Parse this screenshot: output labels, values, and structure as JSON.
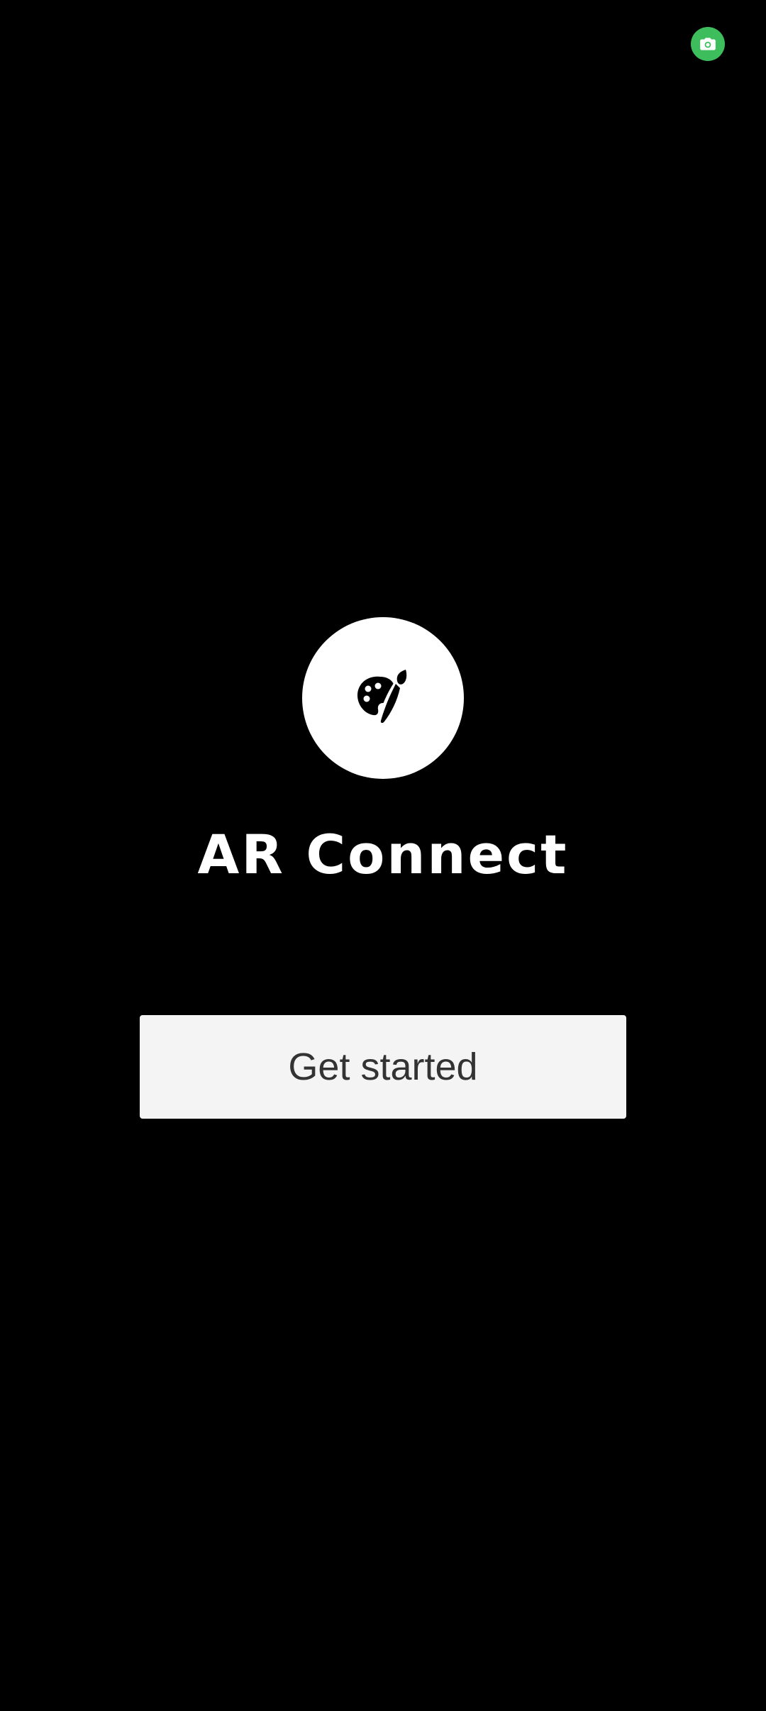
{
  "status": {
    "camera_indicator_icon": "camera-icon",
    "camera_indicator_color": "#3dbd5c"
  },
  "splash": {
    "logo_icon": "palette-brush-icon",
    "app_title": "AR Connect",
    "get_started_label": "Get started"
  },
  "colors": {
    "background": "#000000",
    "logo_circle": "#ffffff",
    "button_background": "#f4f4f4",
    "button_text": "#333333"
  }
}
